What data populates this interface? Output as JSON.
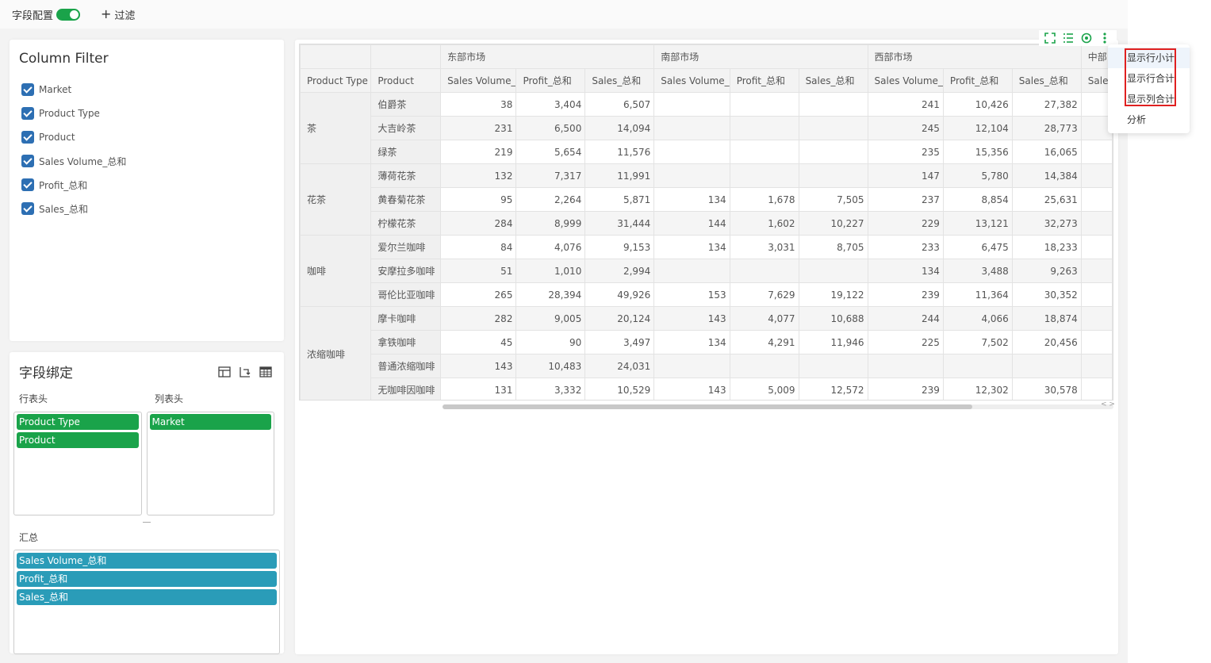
{
  "topbar": {
    "field_config_label": "字段配置",
    "toggle_on": true,
    "filter_label": "过滤"
  },
  "column_filter": {
    "title": "Column Filter",
    "items": [
      {
        "label": "Market",
        "checked": true
      },
      {
        "label": "Product Type",
        "checked": true
      },
      {
        "label": "Product",
        "checked": true
      },
      {
        "label": "Sales Volume_总和",
        "checked": true
      },
      {
        "label": "Profit_总和",
        "checked": true
      },
      {
        "label": "Sales_总和",
        "checked": true
      }
    ]
  },
  "binding": {
    "title": "字段绑定",
    "row_header_label": "行表头",
    "col_header_label": "列表头",
    "row_fields": [
      "Product Type",
      "Product"
    ],
    "col_fields": [
      "Market"
    ],
    "summary_label": "汇总",
    "summary_fields": [
      "Sales Volume_总和",
      "Profit_总和",
      "Sales_总和"
    ]
  },
  "table": {
    "markets": [
      "东部市场",
      "南部市场",
      "西部市场",
      "中部"
    ],
    "row_header_cols": [
      "Product Type",
      "Product"
    ],
    "measure_cols": [
      "Sales Volume_",
      "Profit_总和",
      "Sales_总和"
    ],
    "last_partial_col": "Sale",
    "groups": [
      {
        "type": "茶",
        "rows": [
          {
            "product": "伯爵茶",
            "values": [
              "38",
              "3,404",
              "6,507",
              "",
              "",
              "",
              "241",
              "10,426",
              "27,382"
            ]
          },
          {
            "product": "大吉岭茶",
            "values": [
              "231",
              "6,500",
              "14,094",
              "",
              "",
              "",
              "245",
              "12,104",
              "28,773"
            ]
          },
          {
            "product": "绿茶",
            "values": [
              "219",
              "5,654",
              "11,576",
              "",
              "",
              "",
              "235",
              "15,356",
              "16,065"
            ]
          }
        ]
      },
      {
        "type": "花茶",
        "rows": [
          {
            "product": "薄荷花茶",
            "values": [
              "132",
              "7,317",
              "11,991",
              "",
              "",
              "",
              "147",
              "5,780",
              "14,384"
            ]
          },
          {
            "product": "黄春菊花茶",
            "values": [
              "95",
              "2,264",
              "5,871",
              "134",
              "1,678",
              "7,505",
              "237",
              "8,854",
              "25,631"
            ]
          },
          {
            "product": "柠檬花茶",
            "values": [
              "284",
              "8,999",
              "31,444",
              "144",
              "1,602",
              "10,227",
              "229",
              "13,121",
              "32,273"
            ]
          }
        ]
      },
      {
        "type": "咖啡",
        "rows": [
          {
            "product": "爱尔兰咖啡",
            "values": [
              "84",
              "4,076",
              "9,153",
              "134",
              "3,031",
              "8,705",
              "233",
              "6,475",
              "18,233"
            ]
          },
          {
            "product": "安摩拉多咖啡",
            "values": [
              "51",
              "1,010",
              "2,994",
              "",
              "",
              "",
              "134",
              "3,488",
              "9,263"
            ]
          },
          {
            "product": "哥伦比亚咖啡",
            "values": [
              "265",
              "28,394",
              "49,926",
              "153",
              "7,629",
              "19,122",
              "239",
              "11,364",
              "30,352"
            ]
          }
        ]
      },
      {
        "type": "浓缩咖啡",
        "rows": [
          {
            "product": "摩卡咖啡",
            "values": [
              "282",
              "9,005",
              "20,124",
              "143",
              "4,077",
              "10,688",
              "244",
              "4,066",
              "18,874"
            ]
          },
          {
            "product": "拿铁咖啡",
            "values": [
              "45",
              "90",
              "3,497",
              "134",
              "4,291",
              "11,946",
              "225",
              "7,502",
              "20,456"
            ]
          },
          {
            "product": "普通浓缩咖啡",
            "values": [
              "143",
              "10,483",
              "24,031",
              "",
              "",
              "",
              "",
              "",
              ""
            ]
          },
          {
            "product": "无咖啡因咖啡",
            "values": [
              "131",
              "3,332",
              "10,529",
              "143",
              "5,009",
              "12,572",
              "239",
              "12,302",
              "30,578"
            ]
          }
        ]
      }
    ]
  },
  "menu": {
    "items": [
      "显示行小计",
      "显示行合计",
      "显示列合计",
      "分析"
    ]
  },
  "colors": {
    "accent_green": "#1aa34a",
    "chip_blue": "#2a9cb8",
    "checkbox_blue": "#2d6fb3",
    "highlight_red": "#e02020"
  }
}
